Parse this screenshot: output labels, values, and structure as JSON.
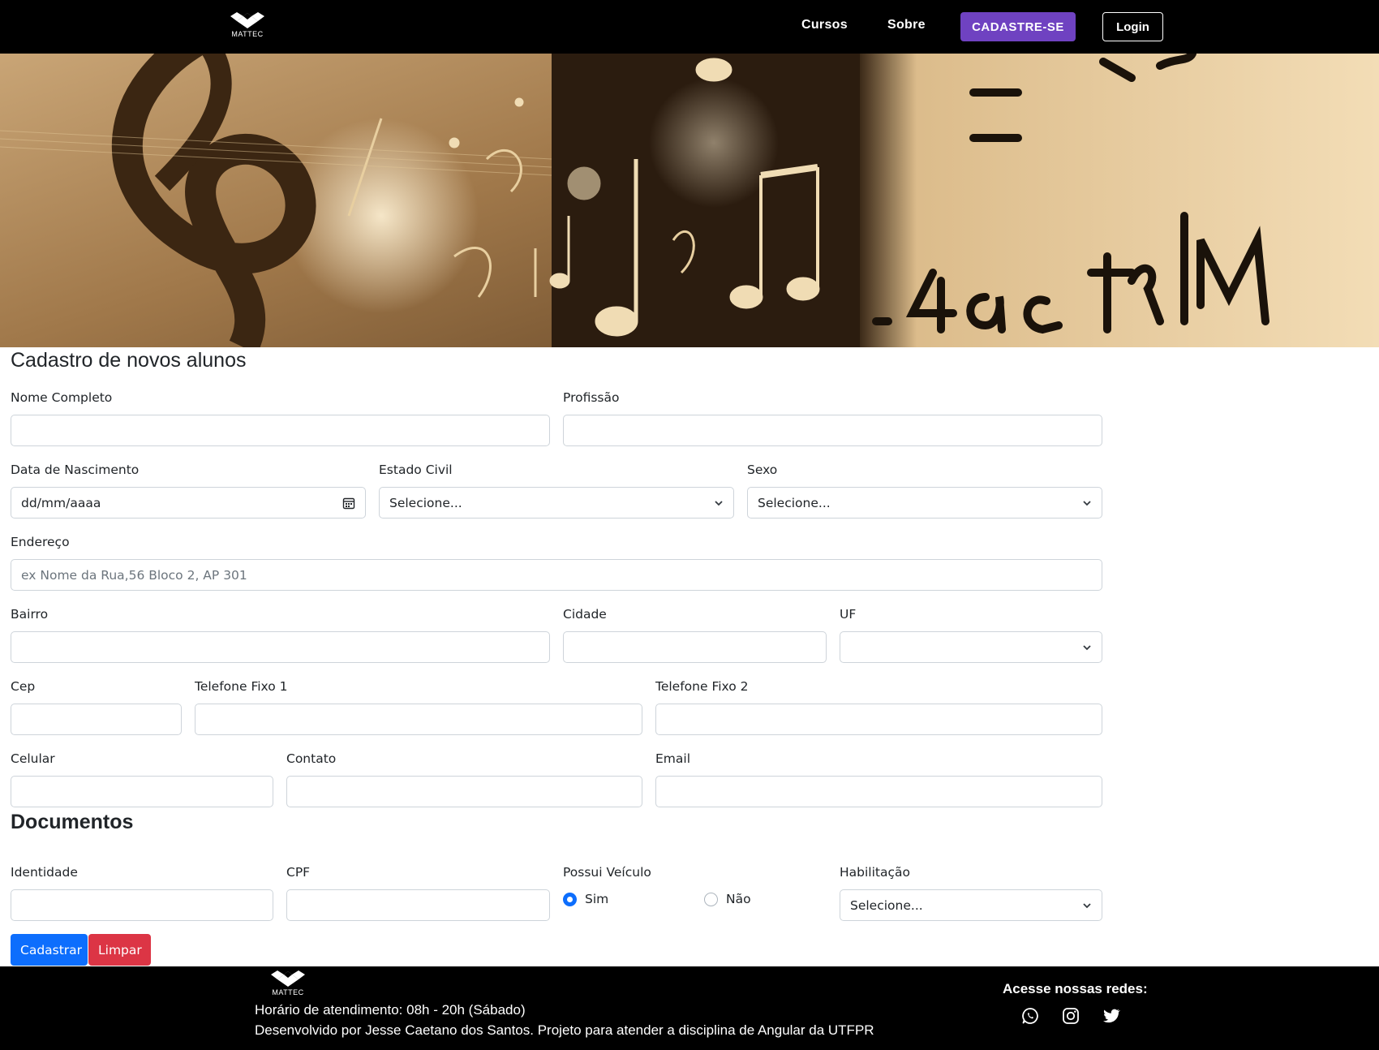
{
  "nav": {
    "logo_text": "MATTEC",
    "links": [
      "Cursos",
      "Sobre"
    ],
    "signup_label": "CADASTRE-SE",
    "login_label": "Login"
  },
  "form": {
    "title": "Cadastro de novos alunos",
    "nome_label": "Nome Completo",
    "profissao_label": "Profissão",
    "nascimento_label": "Data de Nascimento",
    "nascimento_value": "dd/mm/aaaa",
    "estado_civil_label": "Estado Civil",
    "estado_civil_value": "Selecione...",
    "sexo_label": "Sexo",
    "sexo_value": "Selecione...",
    "endereco_label": "Endereço",
    "endereco_placeholder": "ex Nome da Rua,56 Bloco 2, AP 301",
    "bairro_label": "Bairro",
    "cidade_label": "Cidade",
    "uf_label": "UF",
    "uf_value": "",
    "cep_label": "Cep",
    "tel1_label": "Telefone Fixo 1",
    "tel2_label": "Telefone Fixo 2",
    "celular_label": "Celular",
    "contato_label": "Contato",
    "email_label": "Email"
  },
  "documentos": {
    "title": "Documentos",
    "identidade_label": "Identidade",
    "cpf_label": "CPF",
    "veiculo_label": "Possui Veículo",
    "veiculo_options": [
      "Sim",
      "Não"
    ],
    "veiculo_selected": "Sim",
    "habilitacao_label": "Habilitação",
    "habilitacao_value": "Selecione..."
  },
  "actions": {
    "submit_label": "Cadastrar",
    "clear_label": "Limpar"
  },
  "footer": {
    "logo_text": "MATTEC",
    "hours": "Horário de atendimento: 08h - 20h (Sábado)",
    "developer": "Desenvolvido por Jesse Caetano dos Santos. Projeto para atender a disciplina de Angular da UTFPR",
    "social_title": "Acesse nossas redes:",
    "social_icons": [
      "whatsapp-icon",
      "instagram-icon",
      "twitter-icon"
    ]
  },
  "colors": {
    "primary": "#0d6efd",
    "danger": "#dc3545",
    "signup": "#6f42c1",
    "navbar": "#000000"
  }
}
